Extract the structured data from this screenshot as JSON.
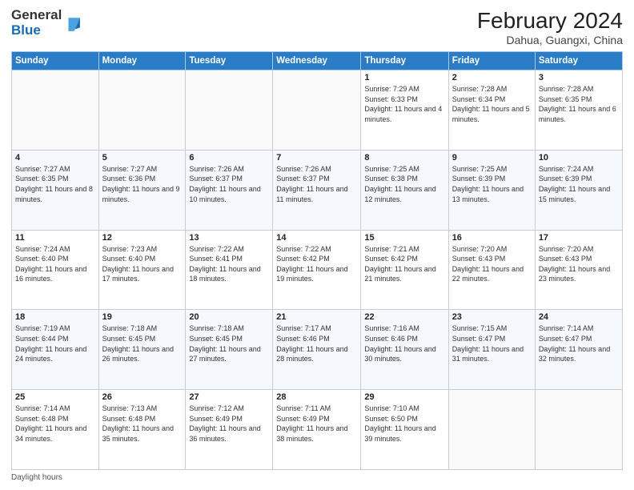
{
  "header": {
    "logo_general": "General",
    "logo_blue": "Blue",
    "month_year": "February 2024",
    "location": "Dahua, Guangxi, China"
  },
  "weekdays": [
    "Sunday",
    "Monday",
    "Tuesday",
    "Wednesday",
    "Thursday",
    "Friday",
    "Saturday"
  ],
  "weeks": [
    [
      {
        "day": "",
        "info": ""
      },
      {
        "day": "",
        "info": ""
      },
      {
        "day": "",
        "info": ""
      },
      {
        "day": "",
        "info": ""
      },
      {
        "day": "1",
        "info": "Sunrise: 7:29 AM\nSunset: 6:33 PM\nDaylight: 11 hours and 4 minutes."
      },
      {
        "day": "2",
        "info": "Sunrise: 7:28 AM\nSunset: 6:34 PM\nDaylight: 11 hours and 5 minutes."
      },
      {
        "day": "3",
        "info": "Sunrise: 7:28 AM\nSunset: 6:35 PM\nDaylight: 11 hours and 6 minutes."
      }
    ],
    [
      {
        "day": "4",
        "info": "Sunrise: 7:27 AM\nSunset: 6:35 PM\nDaylight: 11 hours and 8 minutes."
      },
      {
        "day": "5",
        "info": "Sunrise: 7:27 AM\nSunset: 6:36 PM\nDaylight: 11 hours and 9 minutes."
      },
      {
        "day": "6",
        "info": "Sunrise: 7:26 AM\nSunset: 6:37 PM\nDaylight: 11 hours and 10 minutes."
      },
      {
        "day": "7",
        "info": "Sunrise: 7:26 AM\nSunset: 6:37 PM\nDaylight: 11 hours and 11 minutes."
      },
      {
        "day": "8",
        "info": "Sunrise: 7:25 AM\nSunset: 6:38 PM\nDaylight: 11 hours and 12 minutes."
      },
      {
        "day": "9",
        "info": "Sunrise: 7:25 AM\nSunset: 6:39 PM\nDaylight: 11 hours and 13 minutes."
      },
      {
        "day": "10",
        "info": "Sunrise: 7:24 AM\nSunset: 6:39 PM\nDaylight: 11 hours and 15 minutes."
      }
    ],
    [
      {
        "day": "11",
        "info": "Sunrise: 7:24 AM\nSunset: 6:40 PM\nDaylight: 11 hours and 16 minutes."
      },
      {
        "day": "12",
        "info": "Sunrise: 7:23 AM\nSunset: 6:40 PM\nDaylight: 11 hours and 17 minutes."
      },
      {
        "day": "13",
        "info": "Sunrise: 7:22 AM\nSunset: 6:41 PM\nDaylight: 11 hours and 18 minutes."
      },
      {
        "day": "14",
        "info": "Sunrise: 7:22 AM\nSunset: 6:42 PM\nDaylight: 11 hours and 19 minutes."
      },
      {
        "day": "15",
        "info": "Sunrise: 7:21 AM\nSunset: 6:42 PM\nDaylight: 11 hours and 21 minutes."
      },
      {
        "day": "16",
        "info": "Sunrise: 7:20 AM\nSunset: 6:43 PM\nDaylight: 11 hours and 22 minutes."
      },
      {
        "day": "17",
        "info": "Sunrise: 7:20 AM\nSunset: 6:43 PM\nDaylight: 11 hours and 23 minutes."
      }
    ],
    [
      {
        "day": "18",
        "info": "Sunrise: 7:19 AM\nSunset: 6:44 PM\nDaylight: 11 hours and 24 minutes."
      },
      {
        "day": "19",
        "info": "Sunrise: 7:18 AM\nSunset: 6:45 PM\nDaylight: 11 hours and 26 minutes."
      },
      {
        "day": "20",
        "info": "Sunrise: 7:18 AM\nSunset: 6:45 PM\nDaylight: 11 hours and 27 minutes."
      },
      {
        "day": "21",
        "info": "Sunrise: 7:17 AM\nSunset: 6:46 PM\nDaylight: 11 hours and 28 minutes."
      },
      {
        "day": "22",
        "info": "Sunrise: 7:16 AM\nSunset: 6:46 PM\nDaylight: 11 hours and 30 minutes."
      },
      {
        "day": "23",
        "info": "Sunrise: 7:15 AM\nSunset: 6:47 PM\nDaylight: 11 hours and 31 minutes."
      },
      {
        "day": "24",
        "info": "Sunrise: 7:14 AM\nSunset: 6:47 PM\nDaylight: 11 hours and 32 minutes."
      }
    ],
    [
      {
        "day": "25",
        "info": "Sunrise: 7:14 AM\nSunset: 6:48 PM\nDaylight: 11 hours and 34 minutes."
      },
      {
        "day": "26",
        "info": "Sunrise: 7:13 AM\nSunset: 6:48 PM\nDaylight: 11 hours and 35 minutes."
      },
      {
        "day": "27",
        "info": "Sunrise: 7:12 AM\nSunset: 6:49 PM\nDaylight: 11 hours and 36 minutes."
      },
      {
        "day": "28",
        "info": "Sunrise: 7:11 AM\nSunset: 6:49 PM\nDaylight: 11 hours and 38 minutes."
      },
      {
        "day": "29",
        "info": "Sunrise: 7:10 AM\nSunset: 6:50 PM\nDaylight: 11 hours and 39 minutes."
      },
      {
        "day": "",
        "info": ""
      },
      {
        "day": "",
        "info": ""
      }
    ]
  ],
  "footer": "Daylight hours"
}
